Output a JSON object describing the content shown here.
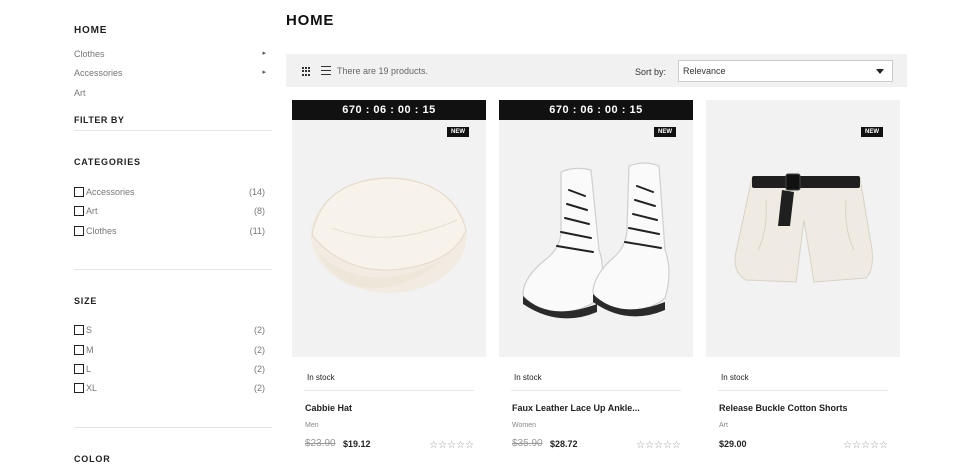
{
  "sidebar": {
    "home": "HOME",
    "categories_nav": [
      {
        "label": "Clothes",
        "arrow": "▸"
      },
      {
        "label": "Accessories",
        "arrow": "▸"
      },
      {
        "label": "Art",
        "arrow": ""
      }
    ],
    "filter_by": "FILTER BY",
    "facets": [
      {
        "title": "CATEGORIES",
        "options": [
          {
            "label": "Accessories",
            "count": "(14)"
          },
          {
            "label": "Art",
            "count": "(8)"
          },
          {
            "label": "Clothes",
            "count": "(11)"
          }
        ]
      },
      {
        "title": "SIZE",
        "options": [
          {
            "label": "S",
            "count": "(2)"
          },
          {
            "label": "M",
            "count": "(2)"
          },
          {
            "label": "L",
            "count": "(2)"
          },
          {
            "label": "XL",
            "count": "(2)"
          }
        ]
      },
      {
        "title": "COLOR",
        "options": []
      }
    ]
  },
  "main": {
    "title": "HOME",
    "toolbar": {
      "product_count": "There are 19 products.",
      "sort_label": "Sort by:",
      "sort_value": "Relevance"
    },
    "products": [
      {
        "countdown": "670 : 06 : 00 : 15",
        "badge": "NEW",
        "image_icon": "hat-image",
        "stock": "In stock",
        "name": "Cabbie Hat",
        "category": "Men",
        "old_price": "$23.90",
        "price": "$19.12",
        "stars": "☆☆☆☆☆"
      },
      {
        "countdown": "670 : 06 : 00 : 15",
        "badge": "NEW",
        "image_icon": "boots-image",
        "stock": "In stock",
        "name": "Faux Leather Lace Up Ankle...",
        "category": "Women",
        "old_price": "$35.90",
        "price": "$28.72",
        "stars": "☆☆☆☆☆"
      },
      {
        "countdown": "",
        "badge": "NEW",
        "image_icon": "shorts-image",
        "stock": "In stock",
        "name": "Release Buckle Cotton Shorts",
        "category": "Art",
        "old_price": "",
        "price": "$29.00",
        "stars": "☆☆☆☆☆"
      }
    ]
  }
}
